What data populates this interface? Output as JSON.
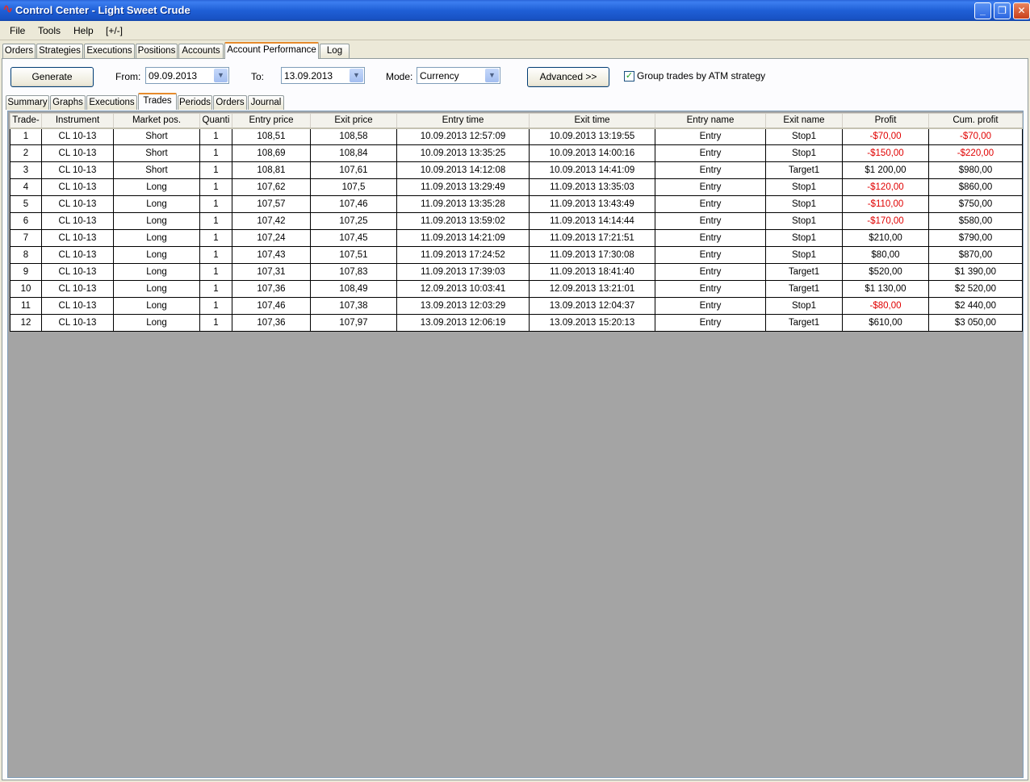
{
  "window": {
    "title": "Control Center - Light Sweet Crude",
    "minimize": "_",
    "restore": "❐",
    "close": "✕"
  },
  "menu": [
    "File",
    "Tools",
    "Help",
    "[+/-]"
  ],
  "tabs": [
    "Orders",
    "Strategies",
    "Executions",
    "Positions",
    "Accounts",
    "Account Performance",
    "Log"
  ],
  "active_tab": "Account Performance",
  "toolbar": {
    "generate_label": "Generate",
    "from_label": "From:",
    "from_value": "09.09.2013",
    "to_label": "To:",
    "to_value": "13.09.2013",
    "mode_label": "Mode:",
    "mode_value": "Currency",
    "advanced_label": "Advanced >>",
    "group_label": "Group trades by ATM strategy",
    "group_checked": true
  },
  "subtabs": [
    "Summary",
    "Graphs",
    "Executions",
    "Trades",
    "Periods",
    "Orders",
    "Journal"
  ],
  "active_subtab": "Trades",
  "colors": {
    "negative": "#e00000",
    "grid_background": "#a4a4a4",
    "active_tab_accent": "#e68b2c"
  },
  "table": {
    "headers": [
      "Trade-",
      "Instrument",
      "Market pos.",
      "Quanti",
      "Entry price",
      "Exit price",
      "Entry time",
      "Exit time",
      "Entry name",
      "Exit name",
      "Profit",
      "Cum. profit"
    ],
    "rows": [
      [
        "1",
        "CL 10-13",
        "Short",
        "1",
        "108,51",
        "108,58",
        "10.09.2013 12:57:09",
        "10.09.2013 13:19:55",
        "Entry",
        "Stop1",
        "-$70,00",
        "-$70,00"
      ],
      [
        "2",
        "CL 10-13",
        "Short",
        "1",
        "108,69",
        "108,84",
        "10.09.2013 13:35:25",
        "10.09.2013 14:00:16",
        "Entry",
        "Stop1",
        "-$150,00",
        "-$220,00"
      ],
      [
        "3",
        "CL 10-13",
        "Short",
        "1",
        "108,81",
        "107,61",
        "10.09.2013 14:12:08",
        "10.09.2013 14:41:09",
        "Entry",
        "Target1",
        "$1 200,00",
        "$980,00"
      ],
      [
        "4",
        "CL 10-13",
        "Long",
        "1",
        "107,62",
        "107,5",
        "11.09.2013 13:29:49",
        "11.09.2013 13:35:03",
        "Entry",
        "Stop1",
        "-$120,00",
        "$860,00"
      ],
      [
        "5",
        "CL 10-13",
        "Long",
        "1",
        "107,57",
        "107,46",
        "11.09.2013 13:35:28",
        "11.09.2013 13:43:49",
        "Entry",
        "Stop1",
        "-$110,00",
        "$750,00"
      ],
      [
        "6",
        "CL 10-13",
        "Long",
        "1",
        "107,42",
        "107,25",
        "11.09.2013 13:59:02",
        "11.09.2013 14:14:44",
        "Entry",
        "Stop1",
        "-$170,00",
        "$580,00"
      ],
      [
        "7",
        "CL 10-13",
        "Long",
        "1",
        "107,24",
        "107,45",
        "11.09.2013 14:21:09",
        "11.09.2013 17:21:51",
        "Entry",
        "Stop1",
        "$210,00",
        "$790,00"
      ],
      [
        "8",
        "CL 10-13",
        "Long",
        "1",
        "107,43",
        "107,51",
        "11.09.2013 17:24:52",
        "11.09.2013 17:30:08",
        "Entry",
        "Stop1",
        "$80,00",
        "$870,00"
      ],
      [
        "9",
        "CL 10-13",
        "Long",
        "1",
        "107,31",
        "107,83",
        "11.09.2013 17:39:03",
        "11.09.2013 18:41:40",
        "Entry",
        "Target1",
        "$520,00",
        "$1 390,00"
      ],
      [
        "10",
        "CL 10-13",
        "Long",
        "1",
        "107,36",
        "108,49",
        "12.09.2013 10:03:41",
        "12.09.2013 13:21:01",
        "Entry",
        "Target1",
        "$1 130,00",
        "$2 520,00"
      ],
      [
        "11",
        "CL 10-13",
        "Long",
        "1",
        "107,46",
        "107,38",
        "13.09.2013 12:03:29",
        "13.09.2013 12:04:37",
        "Entry",
        "Stop1",
        "-$80,00",
        "$2 440,00"
      ],
      [
        "12",
        "CL 10-13",
        "Long",
        "1",
        "107,36",
        "107,97",
        "13.09.2013 12:06:19",
        "13.09.2013 15:20:13",
        "Entry",
        "Target1",
        "$610,00",
        "$3 050,00"
      ]
    ]
  }
}
